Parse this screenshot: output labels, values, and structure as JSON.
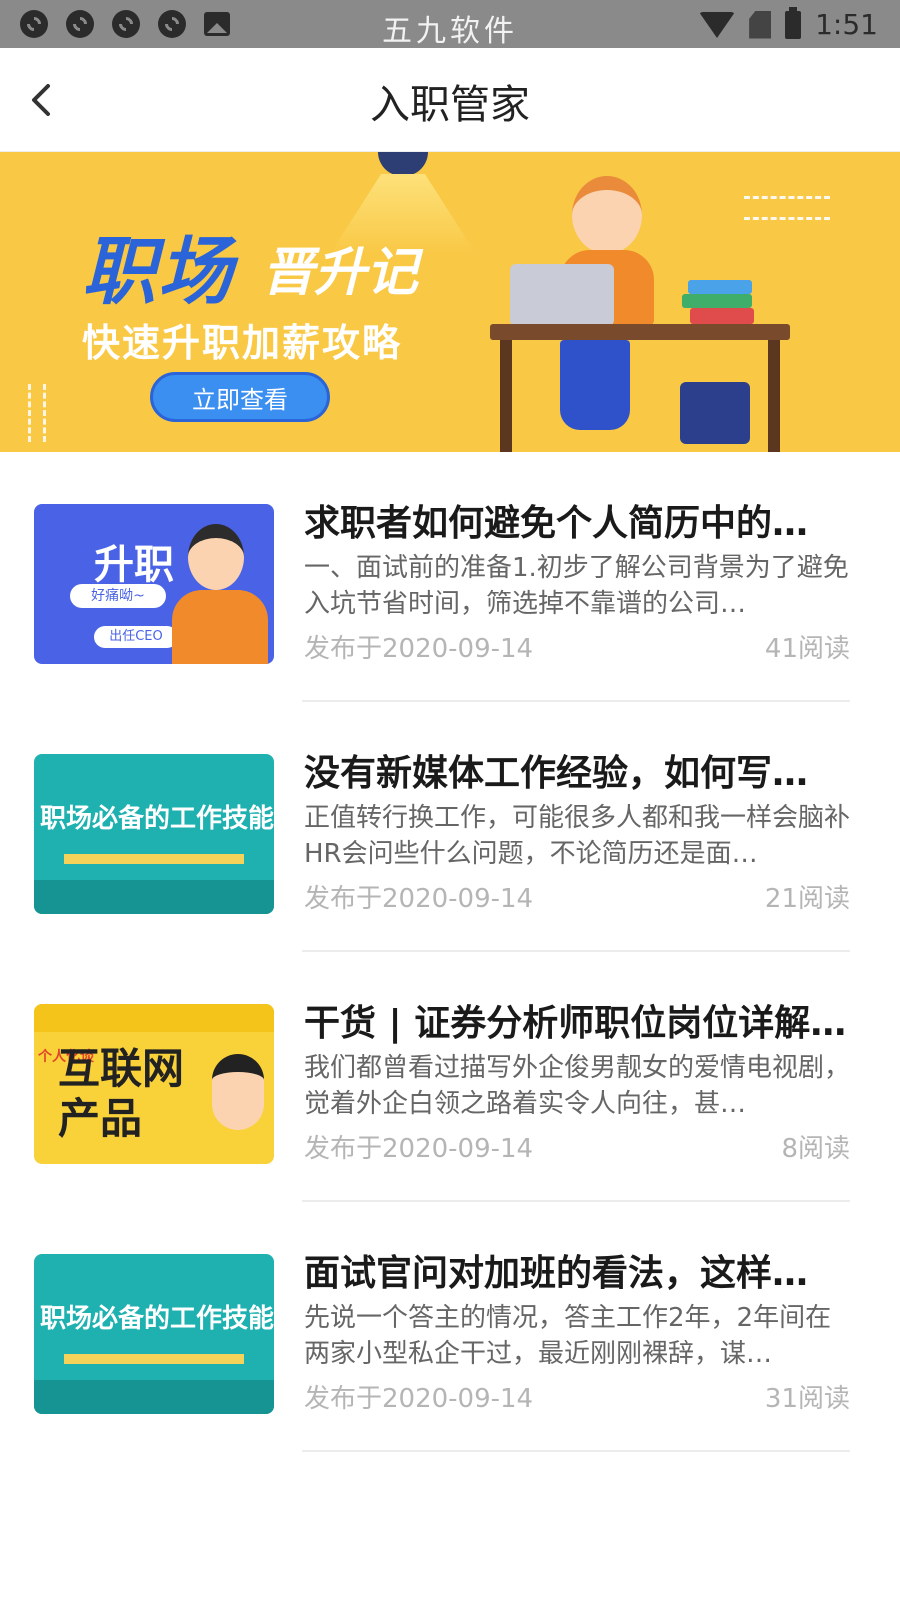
{
  "status_bar": {
    "carrier_text": "五九软件",
    "time": "1:51"
  },
  "nav": {
    "title": "入职管家"
  },
  "banner": {
    "title_main": "职场",
    "title_script": "晋升记",
    "subtitle": "快速升职加薪攻略",
    "button_label": "立即查看"
  },
  "articles": [
    {
      "thumb_style": "blue",
      "thumb_text": "升职",
      "thumb_tags": [
        "好痛呦~",
        "出任CEO"
      ],
      "title": "求职者如何避免个人简历中的…",
      "summary": "一、面试前的准备1.初步了解公司背景为了避免入坑节省时间，筛选掉不靠谱的公司…",
      "date": "发布于2020-09-14",
      "reads": "41阅读"
    },
    {
      "thumb_style": "teal",
      "thumb_text": "职场必备的工作技能",
      "title": "没有新媒体工作经验，如何写…",
      "summary": "正值转行换工作，可能很多人都和我一样会脑补HR会问些什么问题，不论简历还是面…",
      "date": "发布于2020-09-14",
      "reads": "21阅读"
    },
    {
      "thumb_style": "yellow",
      "thumb_text": "互联网\n产品",
      "thumb_tag": "个人化谈",
      "title": "干货 | 证券分析师职位岗位详解…",
      "summary": "我们都曾看过描写外企俊男靓女的爱情电视剧，觉着外企白领之路着实令人向往，甚…",
      "date": "发布于2020-09-14",
      "reads": "8阅读"
    },
    {
      "thumb_style": "teal",
      "thumb_text": "职场必备的工作技能",
      "title": "面试官问对加班的看法，这样…",
      "summary": "先说一个答主的情况，答主工作2年，2年间在两家小型私企干过，最近刚刚裸辞，谋…",
      "date": "发布于2020-09-14",
      "reads": "31阅读"
    }
  ]
}
